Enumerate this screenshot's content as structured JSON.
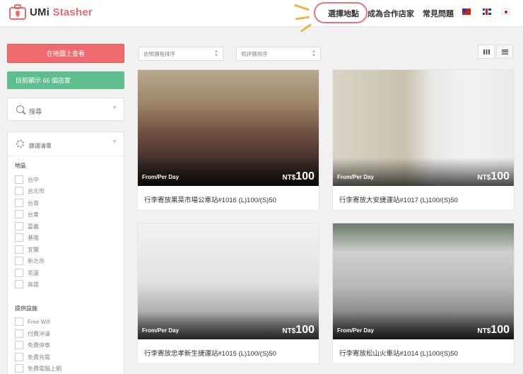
{
  "header": {
    "logo_part1": "UMi",
    "logo_part2": "Stasher",
    "nav": {
      "choose_location": "選擇地點",
      "become_partner": "成為合作店家",
      "faq": "常見問題"
    },
    "languages": [
      "zh-TW flag",
      "en-GB flag",
      "ja flag"
    ]
  },
  "sidebar": {
    "map_button": "在地圖上查看",
    "count_text": "目前顯示 66 個店家",
    "search_label": "搜尋",
    "filter_label": "篩選清單",
    "region_title": "地區",
    "regions": [
      "台中",
      "台北市",
      "台南",
      "台東",
      "嘉義",
      "基隆",
      "宜蘭",
      "新北市",
      "花蓮",
      "高雄"
    ],
    "facility_title": "提供設施",
    "facilities": [
      "Free Wifi",
      "付費沖澡",
      "免費停車",
      "免費充電",
      "免費電腦上網"
    ]
  },
  "toolbar": {
    "sort_price": "依照價格排序",
    "sort_rating": "照評價排序"
  },
  "listings": [
    {
      "per_day": "From/Per Day",
      "currency": "NT$",
      "price": "100",
      "title": "行李寄放果菜市場公車站#1016 (L)100/(S)50"
    },
    {
      "per_day": "From/Per Day",
      "currency": "NT$",
      "price": "100",
      "title": "行李寄放大安捷運站#1017 (L)100/(S)50"
    },
    {
      "per_day": "From/Per Day",
      "currency": "NT$",
      "price": "100",
      "title": "行李寄放忠孝新生捷運站#1015 (L)100/(S)50"
    },
    {
      "per_day": "From/Per Day",
      "currency": "NT$",
      "price": "100",
      "title": "行李寄放松山火車站#1014 (L)100/(S)50"
    }
  ],
  "colors": {
    "brand_red": "#ee6b70",
    "count_green": "#5ebe8e",
    "highlight": "#e8747a",
    "accent_ray": "#f0b43c"
  }
}
